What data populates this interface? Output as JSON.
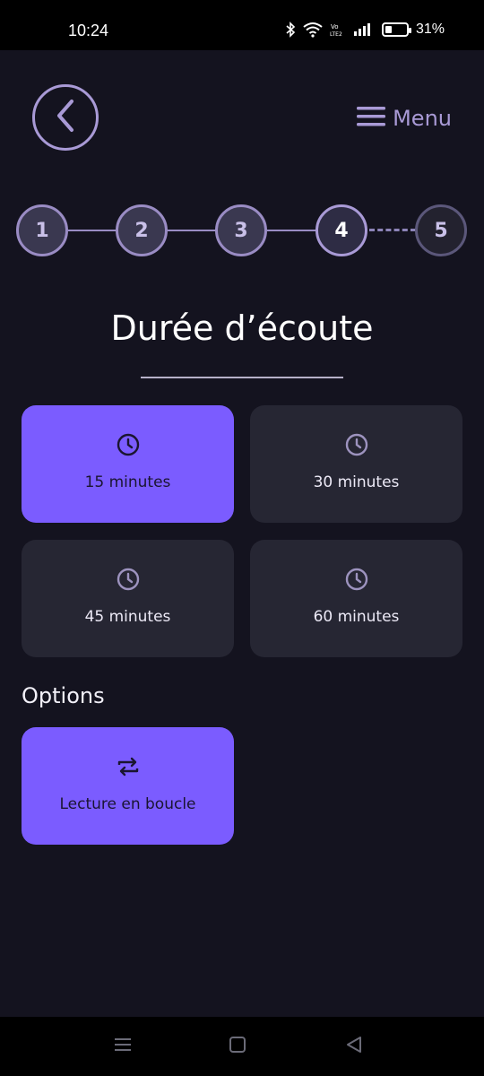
{
  "status_bar": {
    "time": "10:24",
    "battery_text": "31%",
    "battery_level": 0.31
  },
  "header": {
    "back_icon": "chevron-left-icon",
    "menu_label": "Menu",
    "menu_icon": "hamburger-icon"
  },
  "stepper": {
    "steps": [
      {
        "label": "1",
        "state": "done"
      },
      {
        "label": "2",
        "state": "done"
      },
      {
        "label": "3",
        "state": "done"
      },
      {
        "label": "4",
        "state": "current"
      },
      {
        "label": "5",
        "state": "upcoming"
      }
    ]
  },
  "page": {
    "title": "Durée d’écoute"
  },
  "durations": [
    {
      "label": "15 minutes",
      "icon": "clock-icon",
      "selected": true
    },
    {
      "label": "30 minutes",
      "icon": "clock-icon",
      "selected": false
    },
    {
      "label": "45 minutes",
      "icon": "clock-icon",
      "selected": false
    },
    {
      "label": "60 minutes",
      "icon": "clock-icon",
      "selected": false
    }
  ],
  "options": {
    "heading": "Options",
    "items": [
      {
        "label": "Lecture en boucle",
        "icon": "repeat-icon",
        "selected": true
      }
    ]
  },
  "colors": {
    "background": "#14131f",
    "accent": "#7b5cff",
    "card": "#262633",
    "outline": "#a99ad6"
  }
}
